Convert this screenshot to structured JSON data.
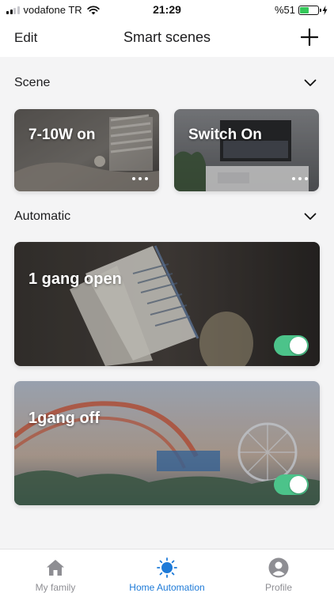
{
  "status_bar": {
    "carrier": "vodafone TR",
    "time": "21:29",
    "battery_text": "%51",
    "battery_level": 0.51
  },
  "nav": {
    "edit_label": "Edit",
    "title": "Smart scenes",
    "add_icon": "plus-icon"
  },
  "sections": {
    "scene": {
      "title": "Scene",
      "chevron": "chevron-down-icon"
    },
    "automatic": {
      "title": "Automatic",
      "chevron": "chevron-down-icon"
    }
  },
  "scenes": [
    {
      "label": "7-10W on",
      "menu_icon": "more-dots-icon"
    },
    {
      "label": "Switch On",
      "menu_icon": "more-dots-icon"
    }
  ],
  "automations": [
    {
      "label": "1 gang open",
      "enabled": true
    },
    {
      "label": "1gang off",
      "enabled": true
    }
  ],
  "tabs": [
    {
      "label": "My family",
      "icon": "home-icon",
      "active": false
    },
    {
      "label": "Home Automation",
      "icon": "sun-icon",
      "active": true
    },
    {
      "label": "Profile",
      "icon": "profile-icon",
      "active": false
    }
  ],
  "colors": {
    "accent": "#1d7ad8",
    "toggle_on": "#4cc38a",
    "battery": "#34c759",
    "inactive_tab": "#8e8e93"
  }
}
